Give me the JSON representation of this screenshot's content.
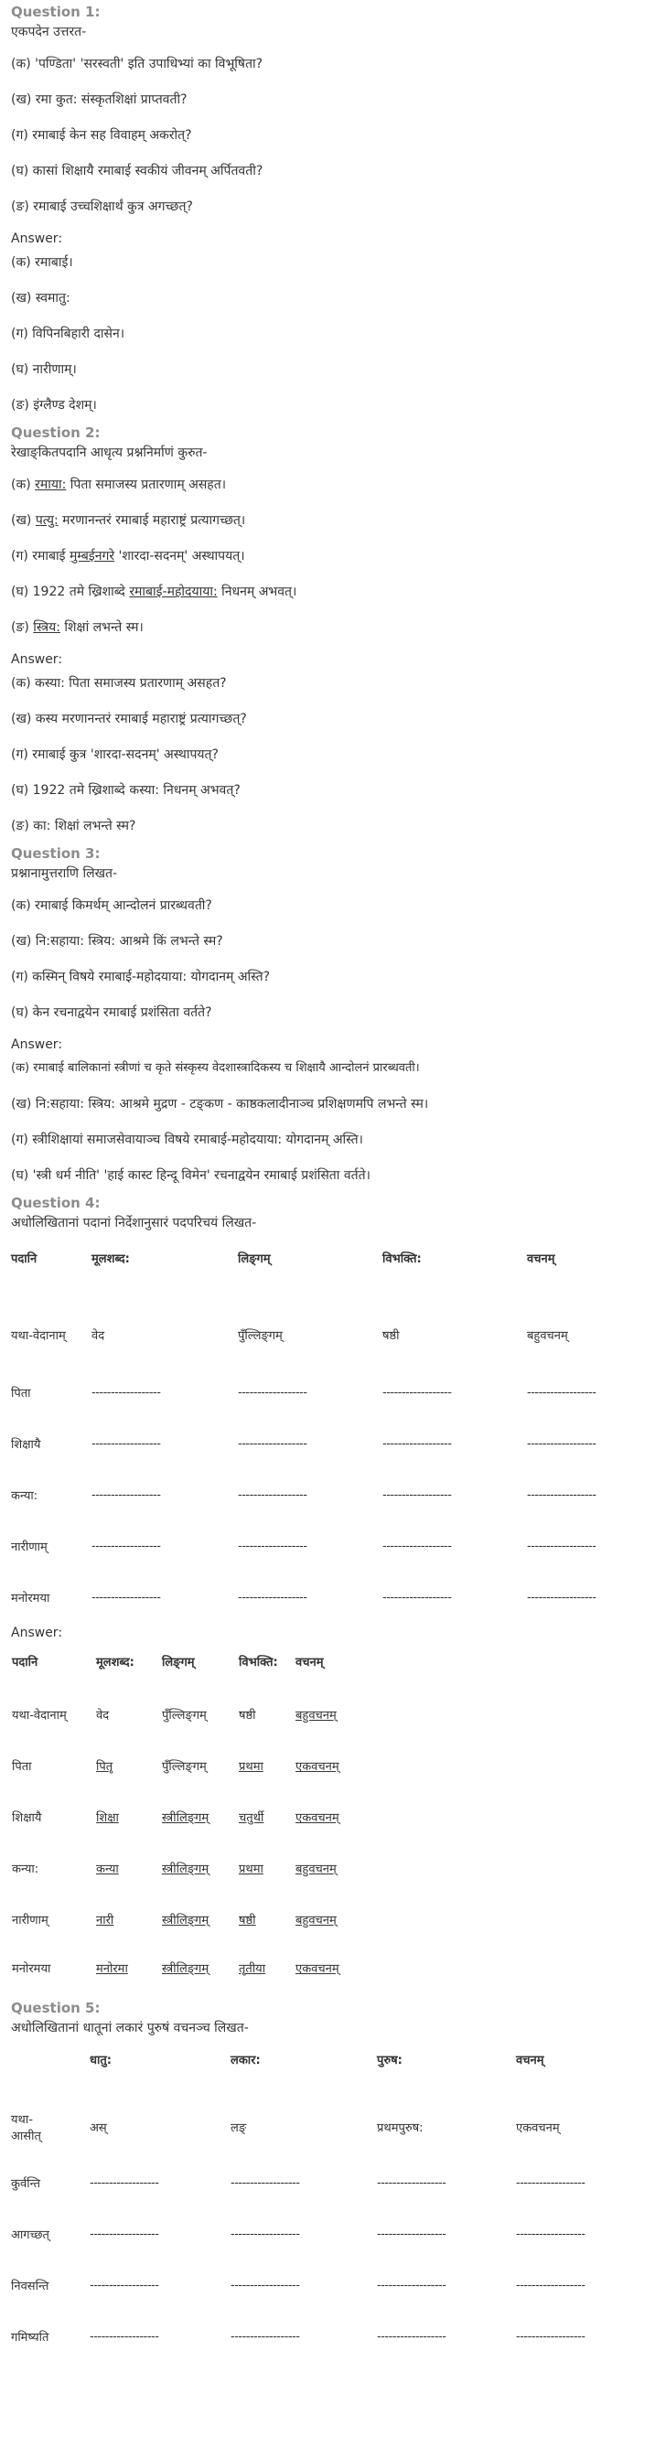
{
  "q1": {
    "title": "Question 1:",
    "instruction": "एकपदेन उत्तरत-",
    "questions": [
      "(क) 'पण्डिता' 'सरस्वती' इति उपाधिभ्यां का विभूषिता?",
      "(ख) रमा कुत: संस्कृतशिक्षां प्राप्तवती?",
      "(ग) रमाबाई केन सह विवाहम् अकरोत्?",
      "(घ) कासां शिक्षायै रमाबाई स्वकीयं जीवनम् अर्पितवती?",
      "(ङ) रमाबाई उच्चशिक्षार्थं कुत्र अगच्छत्?"
    ],
    "answer_label": "Answer:",
    "answers": [
      " (क) रमाबाई।",
      "(ख) स्वमातु:",
      "(ग) विपिनबिहारी दासेन।",
      "(घ) नारीणाम्।",
      "(ङ) इंग्लैण्ड देशम्।"
    ]
  },
  "q2": {
    "title": "Question 2:",
    "instruction": "रेखाङ्‌कितपदानि आधृत्य प्रश्ननिर्माणं कुरुत-",
    "questions": [
      {
        "pre": "(क) ",
        "u": "रमाया:",
        "post": " पिता समाजस्य प्रतारणाम् असहत।"
      },
      {
        "pre": "(ख) ",
        "u": "पत्यु:",
        "post": " मरणानन्तरं रमाबाई महाराष्ट्रं प्रत्यागच्छत्।"
      },
      {
        "pre": "(ग) रमाबाई ",
        "u": "मुम्बईनगरे",
        "post": " 'शारदा-सदनम्' अस्थापयत्।"
      },
      {
        "pre": "(घ) 1922 तमे ख्रिशाब्दे ",
        "u": "रमाबाई-महोदयाया:",
        "post": " निधनम् अभवत्।"
      },
      {
        "pre": "(ङ) ",
        "u": "स्त्रिय:",
        "post": " शिक्षां लभन्ते स्म।"
      }
    ],
    "answer_label": "Answer:",
    "answers": [
      " (क) कस्या: पिता समाजस्य प्रतारणाम् असहत?",
      "(ख) कस्य मरणानन्तरं रमाबाई महाराष्ट्रं प्रत्यागच्छत्?",
      "(ग) रमाबाई कुत्र 'शारदा-सदनम्' अस्थापयत्?",
      "(घ) 1922 तमे ख्रिशाब्दे कस्या: निधनम् अभवत्?",
      "(ङ) का: शिक्षां लभन्ते स्म?"
    ]
  },
  "q3": {
    "title": "Question 3:",
    "instruction": "प्रश्नानामुत्तराणि लिखत-",
    "questions": [
      "(क) रमाबाई किमर्थम् आन्दोलनं प्रारब्धवती?",
      "(ख) नि:सहाया: स्त्रिय: आश्रमे किं लभन्ते स्म?",
      "(ग) कस्मिन् विषये रमाबाई-महोदयाया: योगदानम् अस्ति?",
      "(घ) केन रचनाद्वयेन रमाबाई प्रशंसिता वर्तते?"
    ],
    "answer_label": "Answer:",
    "answers": [
      " (क) रमाबाई बालिकानां स्त्रीणां च कृते संस्कृस्य वेदशास्त्रादिकस्य च शिक्षायै आन्दोलनं प्रारब्धवती।",
      "(ख) नि:सहाया: स्त्रिय: आश्रमे मुद्रण - टङ्‌कण - काष्ठकलादीनाञ्च प्रशिक्षणमपि लभन्ते स्म।",
      "(ग) स्त्रीशिक्षायां समाजसेवायाञ्च विषये रमाबाई-महोदयाया: योगदानम् अस्ति।",
      "(घ) 'स्त्री धर्म नीति' 'हाई कास्ट हिन्दू विमेन' रचनाद्वयेन रमाबाई प्रशंसिता वर्तते।"
    ]
  },
  "q4": {
    "title": "Question 4:",
    "instruction": "अधोलिखितानां पदानां निर्देशानुसारं पदपरिचयं लिखत-",
    "headers": [
      "पदानि",
      "मूलशब्द:",
      "लिङ्‌गम्",
      "विभक्ति:",
      "वचनम्"
    ],
    "example": [
      "यथा-वेदानाम्",
      "वेद",
      "पुँल्लिङ्‌गम्",
      "षष्ठी",
      "बहुवचनम्"
    ],
    "rows": [
      "पिता",
      "शिक्षायै",
      "कन्या:",
      "नारीणाम्",
      "मनोरमया"
    ],
    "blank": "------------------",
    "answer_label": "Answer:",
    "answers": [
      [
        "यथा-वेदानाम्",
        "वेद",
        "पुँल्लिङ्‌गम्",
        "षष्ठी",
        "बहुवचनम्"
      ],
      [
        "पिता",
        "पितृ",
        "पुँल्लिङ्‌गम्",
        "प्रथमा",
        "एकवचनम्"
      ],
      [
        "शिक्षायै",
        "शिक्षा",
        "स्त्रीलिङ्‌गम्",
        "चतुर्थी",
        "एकवचनम्"
      ],
      [
        "कन्या:",
        "कन्या",
        "स्त्रीलिङ्‌गम्",
        "प्रथमा",
        "बहुवचनम्"
      ],
      [
        "नारीणाम्",
        "नारी",
        "स्त्रीलिङ्‌गम्",
        "षष्ठी",
        "बहुवचनम्"
      ],
      [
        "मनोरमया",
        "मनोरमा",
        "स्त्रीलिङ्‌गम्",
        "तृतीया",
        "एकवचनम्"
      ]
    ]
  },
  "q5": {
    "title": "Question 5:",
    "instruction": "अधोलिखितानां धातूनां लकारं पुरुषं वचनञ्च लिखत-",
    "headers": [
      "",
      "धातु:",
      "लकार:",
      "पुरुष:",
      "वचनम्"
    ],
    "example": [
      "यथा-आसीत्",
      "अस्",
      "लङ्",
      "प्रथमपुरुष:",
      "एकवचनम्"
    ],
    "rows": [
      "कुर्वन्ति",
      "आगच्छत्",
      "निवसन्ति",
      "गमिष्यति"
    ],
    "blank": "------------------"
  }
}
